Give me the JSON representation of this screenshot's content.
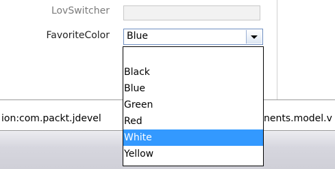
{
  "form": {
    "lov_switcher_label": "LovSwitcher",
    "favorite_color_label": "FavoriteColor",
    "favorite_color_value": "Blue"
  },
  "dropdown": {
    "options": [
      "",
      "Black",
      "Blue",
      "Green",
      "Red",
      "White",
      "Yellow"
    ],
    "highlighted": "White",
    "highlight_color": "#3399ff"
  },
  "status": {
    "left_text": "ion:com.packt.jdevel",
    "right_text": "nents.model.v"
  },
  "colors": {
    "border_combo": "#6c8cc0",
    "label_disabled": "#7a7a7a"
  }
}
